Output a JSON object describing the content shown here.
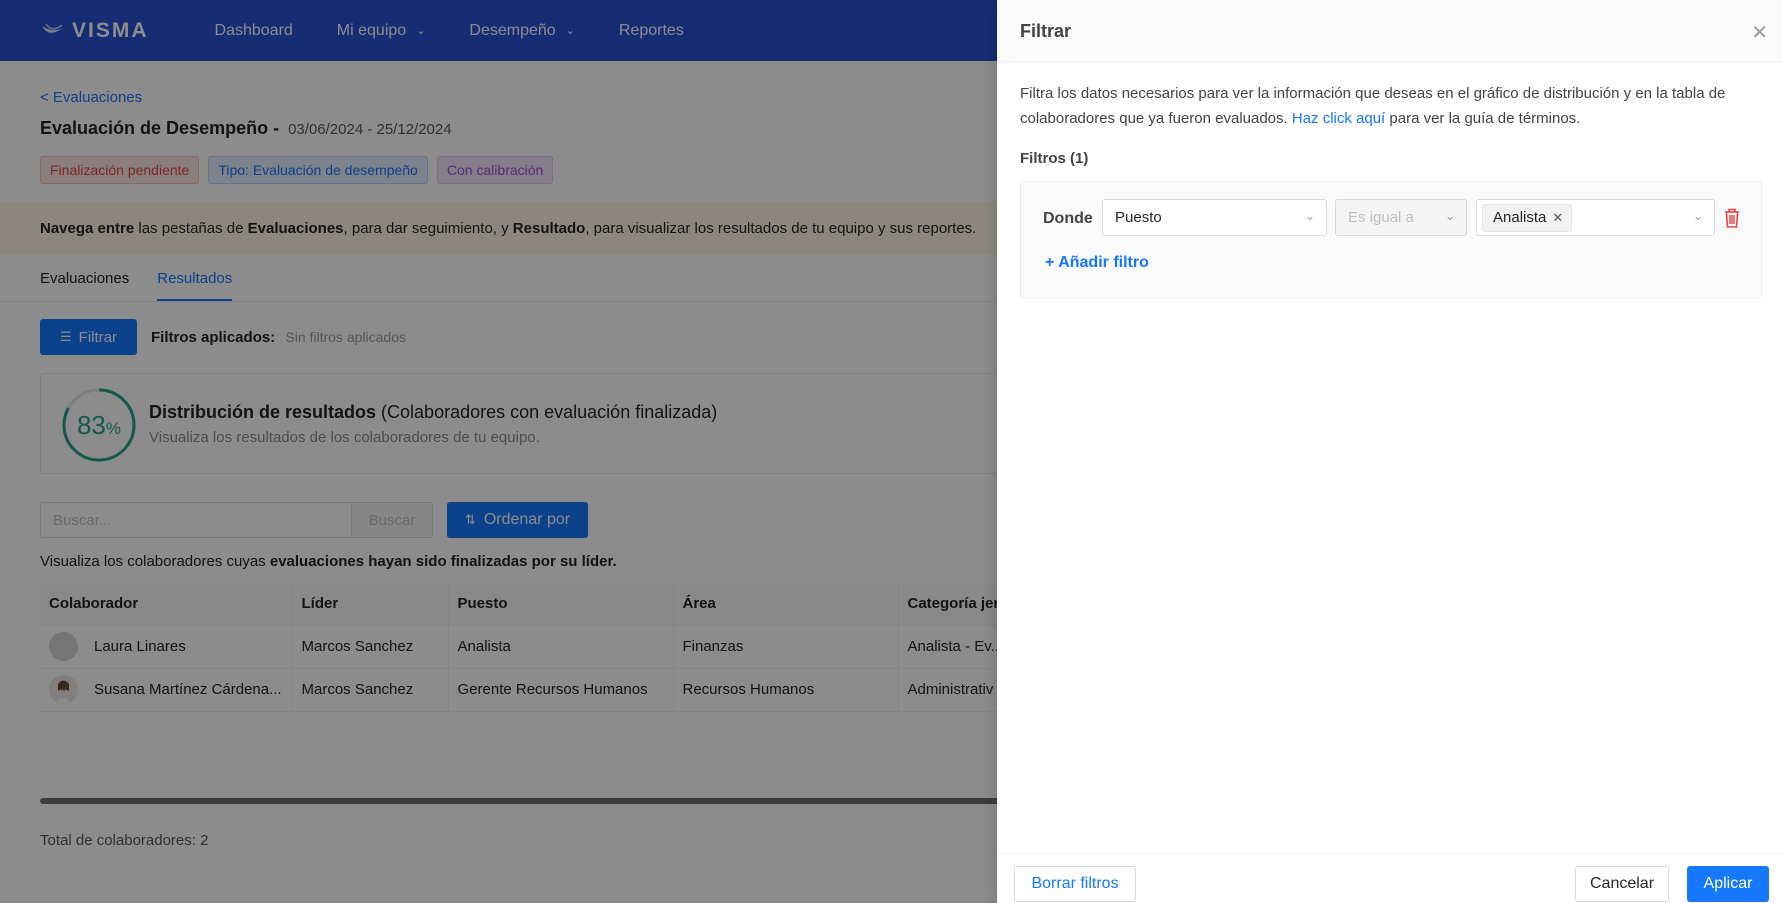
{
  "nav": {
    "logo": "VISMA",
    "items": [
      {
        "label": "Dashboard",
        "has_dropdown": false
      },
      {
        "label": "Mi equipo",
        "has_dropdown": true
      },
      {
        "label": "Desempeño",
        "has_dropdown": true
      },
      {
        "label": "Reportes",
        "has_dropdown": false
      }
    ]
  },
  "page": {
    "back_link": "< Evaluaciones",
    "title": "Evaluación de Desempeño -",
    "dates": "03/06/2024 - 25/12/2024",
    "tags": [
      {
        "label": "Finalización pendiente",
        "color": "#e54545"
      },
      {
        "label": "Tipo: Evaluación de desempeño",
        "color": "#1677ff"
      },
      {
        "label": "Con calibración",
        "color": "#a54fdc"
      }
    ],
    "banner": {
      "b1": "Navega entre",
      "t1": " las pestañas de ",
      "b2": "Evaluaciones",
      "t2": ", para dar seguimiento, y ",
      "b3": "Resultado",
      "t3": ", para visualizar los resultados de tu equipo y sus reportes."
    },
    "tabs": [
      {
        "label": "Evaluaciones",
        "active": false
      },
      {
        "label": "Resultados",
        "active": true
      }
    ],
    "filter_button": "Filtrar",
    "applied_label": "Filtros aplicados:",
    "applied_value": "Sin filtros aplicados",
    "distribution": {
      "percent": 83,
      "percent_value": "83",
      "percent_sign": "%",
      "title_bold": "Distribución de resultados",
      "title_rest": " (Colaboradores con evaluación finalizada)",
      "subtitle": "Visualiza los resultados de los colaboradores de tu equipo."
    },
    "search": {
      "placeholder": "Buscar...",
      "button": "Buscar"
    },
    "order_button": "Ordenar por",
    "info": {
      "text": "Visualiza los colaboradores cuyas ",
      "bold": "evaluaciones hayan sido finalizadas por su líder."
    },
    "table": {
      "headers": [
        "Colaborador",
        "Líder",
        "Puesto",
        "Área",
        "Categoría jer"
      ],
      "rows": [
        {
          "colaborador": "Laura Linares",
          "lider": "Marcos Sanchez",
          "puesto": "Analista",
          "area": "Finanzas",
          "categoria": "Analista - Ev..."
        },
        {
          "colaborador": "Susana Martínez Cárdena...",
          "lider": "Marcos Sanchez",
          "puesto": "Gerente Recursos Humanos",
          "area": "Recursos Humanos",
          "categoria": "Administrativ"
        }
      ]
    },
    "total": "Total de colaboradores: 2"
  },
  "drawer": {
    "title": "Filtrar",
    "description": "Filtra los datos necesarios para ver la información que deseas en el gráfico de distribución y en la tabla de colaboradores que ya fueron evaluados. ",
    "description_link": "Haz click aquí",
    "description_end": " para ver la guía de términos.",
    "filters_count": "Filtros (1)",
    "filter_row": {
      "where_label": "Donde",
      "field": "Puesto",
      "operator": "Es igual a",
      "value_chip": "Analista"
    },
    "add_filter": "+ Añadir filtro",
    "footer": {
      "clear": "Borrar filtros",
      "cancel": "Cancelar",
      "apply": "Aplicar"
    }
  },
  "colors": {
    "nav_bg": "#2953d6",
    "accent": "#1677ff",
    "gauge": "#23a38b",
    "danger": "#e54545"
  }
}
